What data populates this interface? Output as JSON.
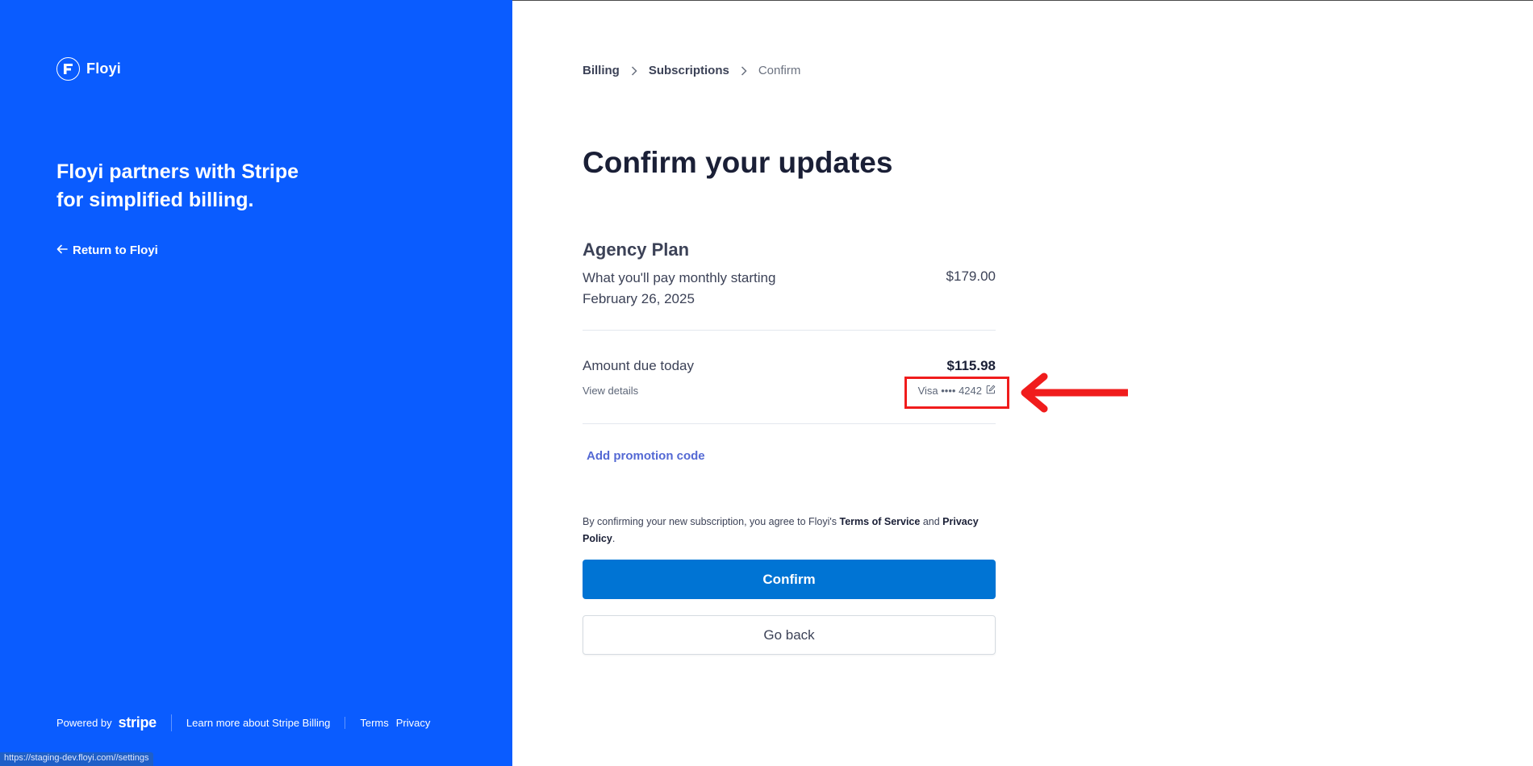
{
  "brand": {
    "name": "Floyi"
  },
  "sidebar": {
    "tagline": "Floyi partners with Stripe for simplified billing.",
    "return_label": "Return to Floyi"
  },
  "footer": {
    "powered_by": "Powered by",
    "stripe": "stripe",
    "learn_more": "Learn more about Stripe Billing",
    "terms": "Terms",
    "privacy": "Privacy"
  },
  "status_bar": {
    "url": "https://staging-dev.floyi.com//settings"
  },
  "breadcrumb": {
    "billing": "Billing",
    "subscriptions": "Subscriptions",
    "confirm": "Confirm"
  },
  "title": "Confirm your updates",
  "plan": {
    "name": "Agency Plan",
    "description": "What you'll pay monthly starting February 26, 2025",
    "price": "$179.00"
  },
  "due": {
    "label": "Amount due today",
    "amount": "$115.98",
    "view_details": "View details",
    "card": "Visa •••• 4242"
  },
  "promo_label": "Add promotion code",
  "terms": {
    "prefix": "By confirming your new subscription, you agree to Floyi's",
    "tos": "Terms of Service",
    "and": "and",
    "privacy": "Privacy Policy",
    "end": "."
  },
  "buttons": {
    "confirm": "Confirm",
    "back": "Go back"
  },
  "colors": {
    "sidebar_bg": "#0a5cff",
    "confirm_bg": "#0074d4",
    "link": "#5469d4",
    "annotation": "#f01c1c"
  }
}
